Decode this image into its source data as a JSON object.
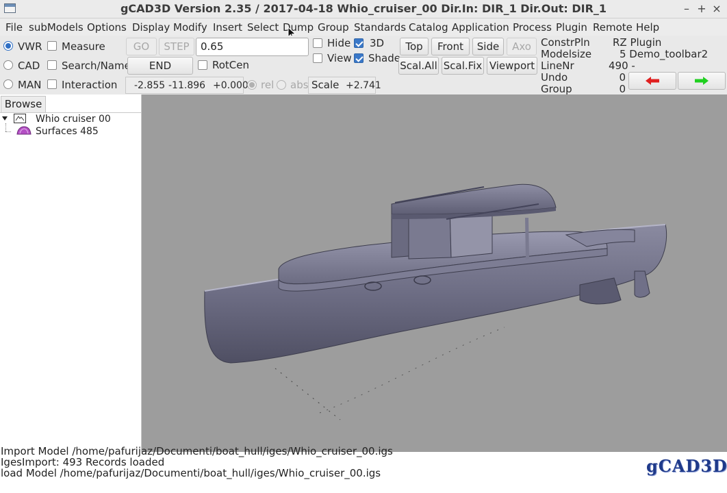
{
  "window": {
    "title": "gCAD3D Version 2.35 / 2017-04-18   Whio_cruiser_00     Dir.In: DIR_1      Dir.Out: DIR_1",
    "controls": {
      "minimize": "–",
      "maximize": "+",
      "close": "×"
    }
  },
  "menubar": [
    "File",
    "subModels",
    "Options",
    "Display",
    "Modify",
    "Insert",
    "Select",
    "Dump",
    "Group",
    "Standards",
    "Catalog",
    "Application",
    "Process",
    "Plugin",
    "Remote",
    "Help"
  ],
  "toolbar": {
    "modes": {
      "vwr": "VWR",
      "cad": "CAD",
      "man": "MAN",
      "selected": "VWR"
    },
    "checks": {
      "measure": "Measure",
      "search": "Search/Name",
      "interaction": "Interaction"
    },
    "go_label": "GO",
    "step_label": "STEP",
    "end_label": "END",
    "step_value": "0.65",
    "rotcen_label": "RotCen",
    "coords": {
      "x": "-2.855",
      "y": "-11.896",
      "z": "+0.000"
    },
    "rel_label": "rel",
    "abs_label": "abs",
    "scale_label": "Scale",
    "scale_value": "+2.741",
    "hide_label": "Hide",
    "view_label": "View",
    "d3_label": "3D",
    "shade_label": "Shade",
    "top_label": "Top",
    "front_label": "Front",
    "side_label": "Side",
    "axo_label": "Axo",
    "scalall_label": "Scal.All",
    "scalfix_label": "Scal.Fix",
    "viewport_label": "Viewport"
  },
  "info": {
    "constrpln_key": "ConstrPln",
    "constrpln_val": "RZ Plugin",
    "modelsize_key": "Modelsize",
    "modelsize_val": "5 Demo_toolbar2",
    "linenr_key": "LineNr",
    "linenr_val": "490 -",
    "undo_key": "Undo",
    "undo_val": "0",
    "group_key": "Group",
    "group_val": "0"
  },
  "browser": {
    "tab_label": "Browse",
    "root_label": "Whio  cruiser  00",
    "child_label": "Surfaces 485"
  },
  "messages": [
    "Import Model /home/pafurijaz/Documenti/boat_hull/iges/Whio_cruiser_00.igs",
    "IgesImport: 493 Records loaded",
    "load Model /home/pafurijaz/Documenti/boat_hull/iges/Whio_cruiser_00.igs"
  ],
  "logo_text": "gCAD3D",
  "colors": {
    "viewport_bg": "#9d9d9d",
    "hull": "#6f6f86",
    "arrow_back": "#e02020",
    "arrow_forward": "#20d020",
    "logo_blue": "#1f3a8a"
  }
}
